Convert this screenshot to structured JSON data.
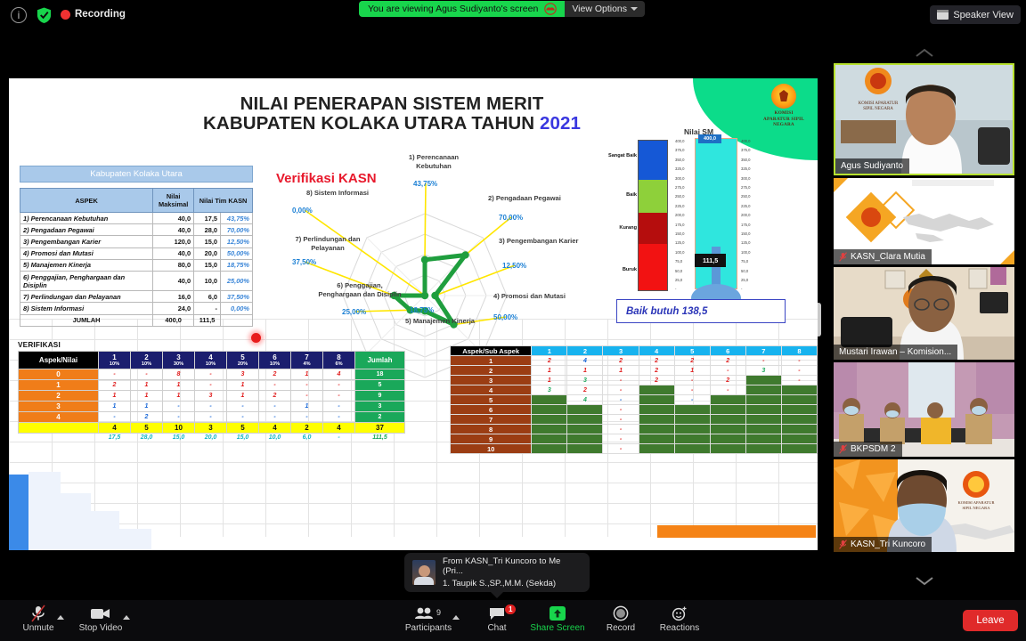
{
  "topbar": {
    "info_icon": "info-icon",
    "shield_icon": "shield-check-icon",
    "recording_label": "Recording",
    "share_banner": "You are viewing Agus Sudiyanto's screen",
    "view_options": "View Options",
    "speaker_view": "Speaker View"
  },
  "slide": {
    "title_line1": "NILAI PENERAPAN SISTEM MERIT",
    "title_line2": "KABUPATEN KOLAKA UTARA TAHUN ",
    "title_year": "2021",
    "logo_text": "KOMISI APARATUR SIPIL NEGARA",
    "aspect_table": {
      "caption": "Kabupaten Kolaka Utara",
      "headers": [
        "ASPEK",
        "Nilai Maksimal",
        "Nilai Tim KASN"
      ],
      "rows": [
        {
          "aspek": "1) Perencanaan Kebutuhan",
          "maks": "40,0",
          "nilai": "17,5",
          "pct": "43,75%"
        },
        {
          "aspek": "2) Pengadaan Pegawai",
          "maks": "40,0",
          "nilai": "28,0",
          "pct": "70,00%"
        },
        {
          "aspek": "3) Pengembangan Karier",
          "maks": "120,0",
          "nilai": "15,0",
          "pct": "12,50%"
        },
        {
          "aspek": "4) Promosi dan Mutasi",
          "maks": "40,0",
          "nilai": "20,0",
          "pct": "50,00%"
        },
        {
          "aspek": "5) Manajemen Kinerja",
          "maks": "80,0",
          "nilai": "15,0",
          "pct": "18,75%"
        },
        {
          "aspek": "6) Penggajian, Penghargaan dan Disiplin",
          "maks": "40,0",
          "nilai": "10,0",
          "pct": "25,00%"
        },
        {
          "aspek": "7) Perlindungan dan Pelayanan",
          "maks": "16,0",
          "nilai": "6,0",
          "pct": "37,50%"
        },
        {
          "aspek": "8) Sistem Informasi",
          "maks": "24,0",
          "nilai": "-",
          "pct": "0,00%"
        }
      ],
      "total": {
        "aspek": "JUMLAH",
        "maks": "400,0",
        "nilai": "111,5",
        "pct": ""
      }
    },
    "radar_heading": "Verifikasi KASN",
    "thermo": {
      "title": "Nilai SM",
      "max_label": "400,0",
      "current_label": "111,5",
      "legend": [
        "Sangat Baik",
        "Baik",
        "Kurang",
        "Buruk"
      ],
      "ticks": [
        "400,0",
        "375,0",
        "350,0",
        "325,0",
        "300,0",
        "275,0",
        "250,0",
        "225,0",
        "200,0",
        "175,0",
        "150,0",
        "125,0",
        "100,0",
        "75,0",
        "50,0",
        "25,0",
        "-"
      ]
    },
    "baik_note": "Baik butuh 138,5",
    "verif": {
      "title": "VERIFIKASI",
      "corner": "Aspek/Nilai",
      "columns": [
        {
          "n": "1",
          "w": "10%"
        },
        {
          "n": "2",
          "w": "10%"
        },
        {
          "n": "3",
          "w": "30%"
        },
        {
          "n": "4",
          "w": "10%"
        },
        {
          "n": "5",
          "w": "20%"
        },
        {
          "n": "6",
          "w": "10%"
        },
        {
          "n": "7",
          "w": "4%"
        },
        {
          "n": "8",
          "w": "6%"
        }
      ],
      "sum_header": "Jumlah",
      "rows": [
        {
          "label": "0",
          "cells": [
            "-",
            "-",
            "8",
            "-",
            "3",
            "2",
            "1",
            "4"
          ],
          "sum": "18"
        },
        {
          "label": "1",
          "cells": [
            "2",
            "1",
            "1",
            "-",
            "1",
            "-",
            "-",
            "-"
          ],
          "sum": "5"
        },
        {
          "label": "2",
          "cells": [
            "1",
            "1",
            "1",
            "3",
            "1",
            "2",
            "-",
            "-"
          ],
          "sum": "9"
        },
        {
          "label": "3",
          "cells": [
            "1",
            "1",
            "-",
            "-",
            "-",
            "-",
            "1",
            "-"
          ],
          "sum": "3"
        },
        {
          "label": "4",
          "cells": [
            "-",
            "2",
            "-",
            "-",
            "-",
            "-",
            "-",
            "-"
          ],
          "sum": "2"
        }
      ],
      "totals": [
        "4",
        "5",
        "10",
        "3",
        "5",
        "4",
        "2",
        "4"
      ],
      "totals_sum": "37",
      "scores": [
        "17,5",
        "28,0",
        "15,0",
        "20,0",
        "15,0",
        "10,0",
        "6,0",
        "-"
      ],
      "scores_sum": "111,5"
    },
    "sub_aspect": {
      "corner": "Aspek/Sub Aspek",
      "columns": [
        "1",
        "2",
        "3",
        "4",
        "5",
        "6",
        "7",
        "8"
      ],
      "rows": [
        {
          "label": "1",
          "cells": [
            "2",
            "4",
            "2",
            "2",
            "2",
            "2",
            "-",
            "-"
          ]
        },
        {
          "label": "2",
          "cells": [
            "1",
            "1",
            "1",
            "2",
            "1",
            "-",
            "3",
            "-"
          ]
        },
        {
          "label": "3",
          "cells": [
            "1",
            "3",
            "-",
            "2",
            "-",
            "2",
            "",
            "-"
          ]
        },
        {
          "label": "4",
          "cells": [
            "3",
            "2",
            "-",
            "",
            "-",
            "-",
            "",
            ""
          ]
        },
        {
          "label": "5",
          "cells": [
            "",
            "4",
            "-",
            "",
            "-",
            "",
            "",
            ""
          ]
        },
        {
          "label": "6",
          "cells": [
            "",
            "",
            "-",
            "",
            "",
            "",
            "",
            ""
          ]
        },
        {
          "label": "7",
          "cells": [
            "",
            "",
            "-",
            "",
            "",
            "",
            "",
            ""
          ]
        },
        {
          "label": "8",
          "cells": [
            "",
            "",
            "-",
            "",
            "",
            "",
            "",
            ""
          ]
        },
        {
          "label": "9",
          "cells": [
            "",
            "",
            "-",
            "",
            "",
            "",
            "",
            ""
          ]
        },
        {
          "label": "10",
          "cells": [
            "",
            "",
            "-",
            "",
            "",
            "",
            "",
            ""
          ]
        }
      ]
    }
  },
  "chart_data": {
    "type": "radar",
    "title": "Verifikasi KASN",
    "categories": [
      "1) Perencanaan Kebutuhan",
      "2) Pengadaan Pegawai",
      "3) Pengembangan Karier",
      "4) Promosi dan Mutasi",
      "5) Manajemen Kinerja",
      "6) Penggajian, Penghargaan dan Disiplin",
      "7) Perlindungan dan Pelayanan",
      "8) Sistem Informasi"
    ],
    "values": [
      43.75,
      70.0,
      12.5,
      50.0,
      18.75,
      25.0,
      37.5,
      0.0
    ],
    "value_labels": [
      "43,75%",
      "70,00%",
      "12,50%",
      "50,00%",
      "18,75%",
      "25,00%",
      "37,50%",
      "0,00%"
    ],
    "unit": "%",
    "ylim": [
      0,
      100
    ],
    "grid": true,
    "legend": "none",
    "series_color": "#1f9e3e"
  },
  "tiles": [
    {
      "name": "Agus Sudiyanto",
      "active": true,
      "muted": false
    },
    {
      "name": "KASN_Clara Mutia",
      "active": false,
      "muted": true
    },
    {
      "name": "Mustari Irawan – Komision...",
      "active": false,
      "muted": false
    },
    {
      "name": "BKPSDM 2",
      "active": false,
      "muted": true
    },
    {
      "name": "KASN_Tri Kuncoro",
      "active": false,
      "muted": true
    }
  ],
  "toast": {
    "line1": "From KASN_Tri Kuncoro to Me (Pri...",
    "line2": "1. Taupik S.,SP.,M.M. (Sekda)"
  },
  "bottombar": {
    "items": [
      {
        "label": "Unmute",
        "icon": "microphone-muted-icon",
        "caret": true
      },
      {
        "label": "Stop Video",
        "icon": "camera-icon",
        "caret": true
      },
      {
        "label": "Participants",
        "icon": "participants-icon",
        "count": "9",
        "caret": true
      },
      {
        "label": "Chat",
        "icon": "chat-icon",
        "badge": "1"
      },
      {
        "label": "Share Screen",
        "icon": "share-screen-icon",
        "active": true
      },
      {
        "label": "Record",
        "icon": "record-icon"
      },
      {
        "label": "Reactions",
        "icon": "reactions-icon"
      }
    ],
    "leave_label": "Leave"
  },
  "colors": {
    "share_green": "#18d54c",
    "leave_red": "#e02a2a",
    "accent_blue": "#3a38e0",
    "table_green": "#1aa85a",
    "table_orange": "#f07d19"
  }
}
